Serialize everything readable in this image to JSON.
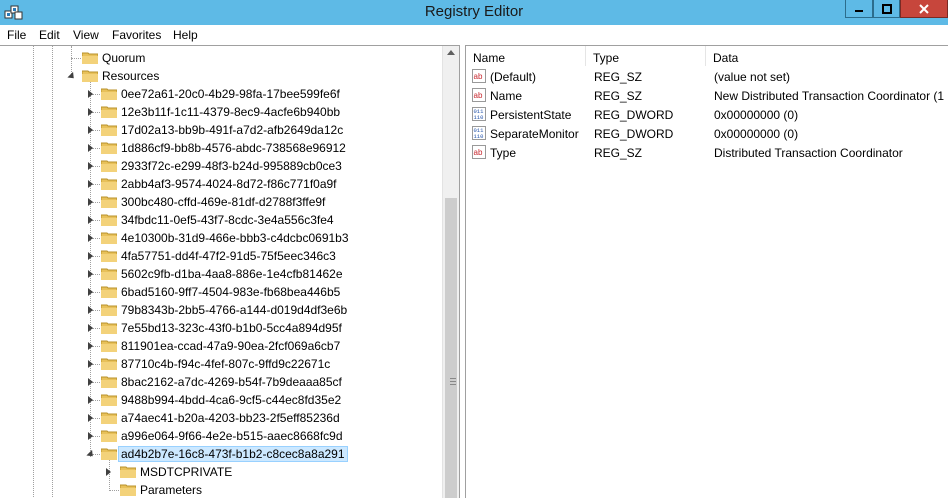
{
  "window": {
    "title": "Registry Editor",
    "app_icon": "registry-editor-icon"
  },
  "menu": [
    "File",
    "Edit",
    "View",
    "Favorites",
    "Help"
  ],
  "tree": {
    "quorum": "Quorum",
    "resources": "Resources",
    "children": [
      "0ee72a61-20c0-4b29-98fa-17bee599fe6f",
      "12e3b11f-1c11-4379-8ec9-4acfe6b940bb",
      "17d02a13-bb9b-491f-a7d2-afb2649da12c",
      "1d886cf9-bb8b-4576-abdc-738568e96912",
      "2933f72c-e299-48f3-b24d-995889cb0ce3",
      "2abb4af3-9574-4024-8d72-f86c771f0a9f",
      "300bc480-cffd-469e-81df-d2788f3ffe9f",
      "34fbdc11-0ef5-43f7-8cdc-3e4a556c3fe4",
      "4e10300b-31d9-466e-bbb3-c4dcbc0691b3",
      "4fa57751-dd4f-47f2-91d5-75f5eec346c3",
      "5602c9fb-d1ba-4aa8-886e-1e4cfb81462e",
      "6bad5160-9ff7-4504-983e-fb68bea446b5",
      "79b8343b-2bb5-4766-a144-d019d4df3e6b",
      "7e55bd13-323c-43f0-b1b0-5cc4a894d95f",
      "811901ea-ccad-47a9-90ea-2fcf069a6cb7",
      "87710c4b-f94c-4fef-807c-9ffd9c22671c",
      "8bac2162-a7dc-4269-b54f-7b9deaaa85cf",
      "9488b994-4bdd-4ca6-9cf5-c44ec8fd35e2",
      "a74aec41-b20a-4203-bb23-2f5eff85236d",
      "a996e064-9f66-4e2e-b515-aaec8668fc9d"
    ],
    "selected": "ad4b2b7e-16c8-473f-b1b2-c8cec8a8a291",
    "selected_children": [
      "MSDTCPRIVATE",
      "Parameters"
    ]
  },
  "columns": {
    "name": "Name",
    "type": "Type",
    "data": "Data"
  },
  "values": [
    {
      "icon": "string-value-icon",
      "name": "(Default)",
      "type": "REG_SZ",
      "data": "(value not set)"
    },
    {
      "icon": "string-value-icon",
      "name": "Name",
      "type": "REG_SZ",
      "data": "New Distributed Transaction Coordinator (1"
    },
    {
      "icon": "binary-value-icon",
      "name": "PersistentState",
      "type": "REG_DWORD",
      "data": "0x00000000 (0)"
    },
    {
      "icon": "binary-value-icon",
      "name": "SeparateMonitor",
      "type": "REG_DWORD",
      "data": "0x00000000 (0)"
    },
    {
      "icon": "string-value-icon",
      "name": "Type",
      "type": "REG_SZ",
      "data": "Distributed Transaction Coordinator"
    }
  ],
  "colors": {
    "titlebar": "#5ebae6",
    "close": "#c7463c",
    "selection": "#cce8ff",
    "folder": "#e8c15a"
  }
}
